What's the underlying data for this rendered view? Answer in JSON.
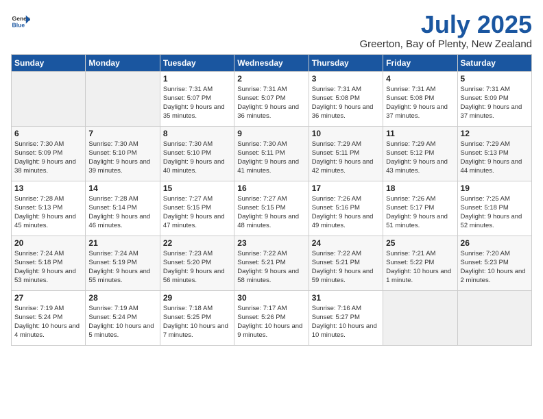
{
  "header": {
    "logo_general": "General",
    "logo_blue": "Blue",
    "month": "July 2025",
    "location": "Greerton, Bay of Plenty, New Zealand"
  },
  "weekdays": [
    "Sunday",
    "Monday",
    "Tuesday",
    "Wednesday",
    "Thursday",
    "Friday",
    "Saturday"
  ],
  "weeks": [
    [
      {
        "day": "",
        "info": ""
      },
      {
        "day": "",
        "info": ""
      },
      {
        "day": "1",
        "info": "Sunrise: 7:31 AM\nSunset: 5:07 PM\nDaylight: 9 hours and 35 minutes."
      },
      {
        "day": "2",
        "info": "Sunrise: 7:31 AM\nSunset: 5:07 PM\nDaylight: 9 hours and 36 minutes."
      },
      {
        "day": "3",
        "info": "Sunrise: 7:31 AM\nSunset: 5:08 PM\nDaylight: 9 hours and 36 minutes."
      },
      {
        "day": "4",
        "info": "Sunrise: 7:31 AM\nSunset: 5:08 PM\nDaylight: 9 hours and 37 minutes."
      },
      {
        "day": "5",
        "info": "Sunrise: 7:31 AM\nSunset: 5:09 PM\nDaylight: 9 hours and 37 minutes."
      }
    ],
    [
      {
        "day": "6",
        "info": "Sunrise: 7:30 AM\nSunset: 5:09 PM\nDaylight: 9 hours and 38 minutes."
      },
      {
        "day": "7",
        "info": "Sunrise: 7:30 AM\nSunset: 5:10 PM\nDaylight: 9 hours and 39 minutes."
      },
      {
        "day": "8",
        "info": "Sunrise: 7:30 AM\nSunset: 5:10 PM\nDaylight: 9 hours and 40 minutes."
      },
      {
        "day": "9",
        "info": "Sunrise: 7:30 AM\nSunset: 5:11 PM\nDaylight: 9 hours and 41 minutes."
      },
      {
        "day": "10",
        "info": "Sunrise: 7:29 AM\nSunset: 5:11 PM\nDaylight: 9 hours and 42 minutes."
      },
      {
        "day": "11",
        "info": "Sunrise: 7:29 AM\nSunset: 5:12 PM\nDaylight: 9 hours and 43 minutes."
      },
      {
        "day": "12",
        "info": "Sunrise: 7:29 AM\nSunset: 5:13 PM\nDaylight: 9 hours and 44 minutes."
      }
    ],
    [
      {
        "day": "13",
        "info": "Sunrise: 7:28 AM\nSunset: 5:13 PM\nDaylight: 9 hours and 45 minutes."
      },
      {
        "day": "14",
        "info": "Sunrise: 7:28 AM\nSunset: 5:14 PM\nDaylight: 9 hours and 46 minutes."
      },
      {
        "day": "15",
        "info": "Sunrise: 7:27 AM\nSunset: 5:15 PM\nDaylight: 9 hours and 47 minutes."
      },
      {
        "day": "16",
        "info": "Sunrise: 7:27 AM\nSunset: 5:15 PM\nDaylight: 9 hours and 48 minutes."
      },
      {
        "day": "17",
        "info": "Sunrise: 7:26 AM\nSunset: 5:16 PM\nDaylight: 9 hours and 49 minutes."
      },
      {
        "day": "18",
        "info": "Sunrise: 7:26 AM\nSunset: 5:17 PM\nDaylight: 9 hours and 51 minutes."
      },
      {
        "day": "19",
        "info": "Sunrise: 7:25 AM\nSunset: 5:18 PM\nDaylight: 9 hours and 52 minutes."
      }
    ],
    [
      {
        "day": "20",
        "info": "Sunrise: 7:24 AM\nSunset: 5:18 PM\nDaylight: 9 hours and 53 minutes."
      },
      {
        "day": "21",
        "info": "Sunrise: 7:24 AM\nSunset: 5:19 PM\nDaylight: 9 hours and 55 minutes."
      },
      {
        "day": "22",
        "info": "Sunrise: 7:23 AM\nSunset: 5:20 PM\nDaylight: 9 hours and 56 minutes."
      },
      {
        "day": "23",
        "info": "Sunrise: 7:22 AM\nSunset: 5:21 PM\nDaylight: 9 hours and 58 minutes."
      },
      {
        "day": "24",
        "info": "Sunrise: 7:22 AM\nSunset: 5:21 PM\nDaylight: 9 hours and 59 minutes."
      },
      {
        "day": "25",
        "info": "Sunrise: 7:21 AM\nSunset: 5:22 PM\nDaylight: 10 hours and 1 minute."
      },
      {
        "day": "26",
        "info": "Sunrise: 7:20 AM\nSunset: 5:23 PM\nDaylight: 10 hours and 2 minutes."
      }
    ],
    [
      {
        "day": "27",
        "info": "Sunrise: 7:19 AM\nSunset: 5:24 PM\nDaylight: 10 hours and 4 minutes."
      },
      {
        "day": "28",
        "info": "Sunrise: 7:19 AM\nSunset: 5:24 PM\nDaylight: 10 hours and 5 minutes."
      },
      {
        "day": "29",
        "info": "Sunrise: 7:18 AM\nSunset: 5:25 PM\nDaylight: 10 hours and 7 minutes."
      },
      {
        "day": "30",
        "info": "Sunrise: 7:17 AM\nSunset: 5:26 PM\nDaylight: 10 hours and 9 minutes."
      },
      {
        "day": "31",
        "info": "Sunrise: 7:16 AM\nSunset: 5:27 PM\nDaylight: 10 hours and 10 minutes."
      },
      {
        "day": "",
        "info": ""
      },
      {
        "day": "",
        "info": ""
      }
    ]
  ]
}
